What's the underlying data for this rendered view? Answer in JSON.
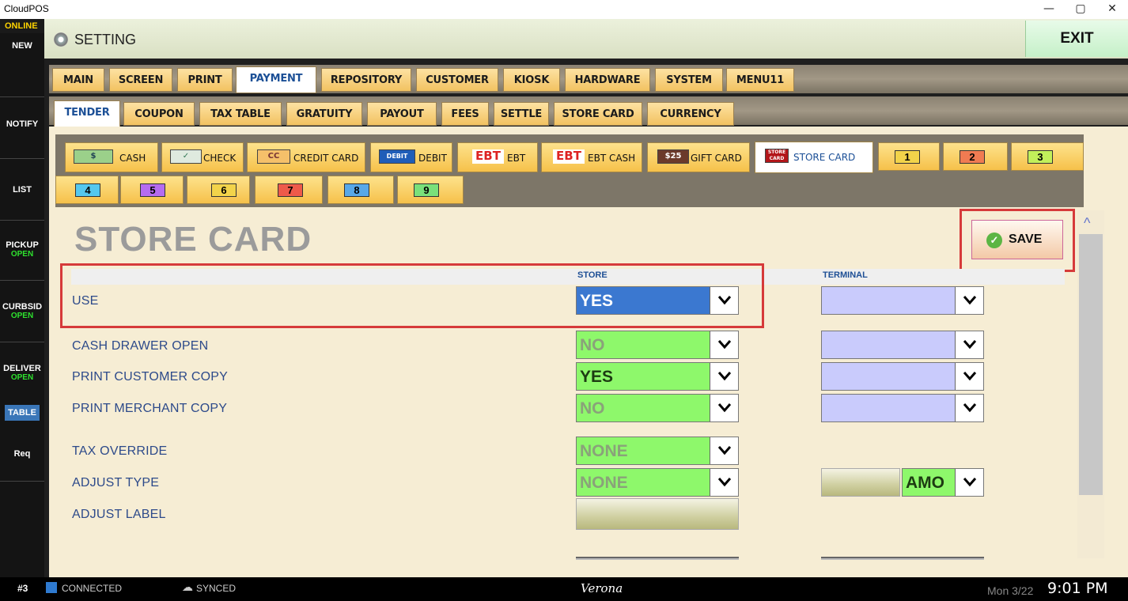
{
  "window": {
    "title": "CloudPOS",
    "min": "—",
    "max": "▢",
    "close": "✕"
  },
  "sidebar": {
    "online": "ONLINE",
    "items": [
      {
        "label": "NEW",
        "sub": ""
      },
      {
        "label": "NOTIFY",
        "sub": ""
      },
      {
        "label": "LIST",
        "sub": ""
      },
      {
        "label": "PICKUP",
        "sub": "OPEN"
      },
      {
        "label": "CURBSID",
        "sub": "OPEN"
      },
      {
        "label": "DELIVER",
        "sub": "OPEN"
      },
      {
        "label": "TABLE",
        "sub": ""
      },
      {
        "label": "Req",
        "sub": ""
      }
    ]
  },
  "header": {
    "title": "SETTING",
    "exit": "EXIT"
  },
  "main_tabs": [
    "MAIN",
    "SCREEN",
    "PRINT",
    "PAYMENT",
    "REPOSITORY",
    "CUSTOMER",
    "KIOSK",
    "HARDWARE",
    "SYSTEM",
    "MENU11"
  ],
  "main_active": "PAYMENT",
  "sub_tabs": [
    "TENDER",
    "COUPON",
    "TAX TABLE",
    "GRATUITY",
    "PAYOUT",
    "FEES",
    "SETTLE",
    "STORE CARD",
    "CURRENCY"
  ],
  "sub_active": "TENDER",
  "tender_tabs": [
    "CASH",
    "CHECK",
    "CREDIT CARD",
    "DEBIT",
    "EBT",
    "EBT CASH",
    "GIFT CARD",
    "STORE CARD"
  ],
  "tender_chips": {
    "cash": "$",
    "check": "✓",
    "credit": "CC",
    "debit": "DEBIT",
    "ebt": "EBT",
    "ebtcash": "EBT",
    "gift": "$25",
    "store": "STORE CARD"
  },
  "num_tabs": [
    "1",
    "2",
    "3",
    "4",
    "5",
    "6",
    "7",
    "8",
    "9"
  ],
  "num_colors": [
    "#f2d34a",
    "#f07b52",
    "#c2f05a",
    "#55c8ee",
    "#b56bf0",
    "#f2d34a",
    "#ee5a4a",
    "#58a8e8",
    "#7ae07a"
  ],
  "page_title": "STORE CARD",
  "save_label": "SAVE",
  "columns": {
    "store": "STORE",
    "terminal": "TERMINAL"
  },
  "rows": [
    {
      "label": "USE",
      "store": "YES",
      "terminal": ""
    },
    {
      "label": "CASH DRAWER OPEN",
      "store": "NO",
      "terminal": ""
    },
    {
      "label": "PRINT CUSTOMER COPY",
      "store": "YES",
      "terminal": ""
    },
    {
      "label": "PRINT MERCHANT COPY",
      "store": "NO",
      "terminal": ""
    },
    {
      "label": "TAX OVERRIDE",
      "store": "NONE"
    },
    {
      "label": "ADJUST TYPE",
      "store": "NONE",
      "terminal_value": "AMO"
    },
    {
      "label": "ADJUST LABEL",
      "store": ""
    }
  ],
  "status": {
    "station": "#3",
    "connected": "CONNECTED",
    "synced": "SYNCED",
    "location": "Verona",
    "date": "Mon 3/22",
    "time": "9:01 PM"
  },
  "colors": {
    "accent_blue": "#3b78d0",
    "green": "#8ef86b",
    "lavender": "#c9cbfc",
    "highlight": "#d63a3a"
  }
}
